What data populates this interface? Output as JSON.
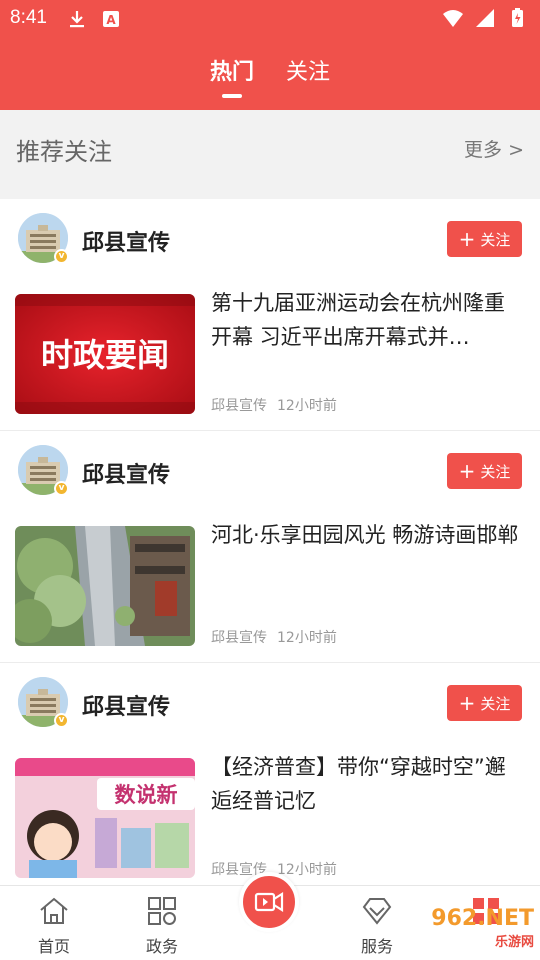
{
  "status_bar": {
    "time": "8:41",
    "icons_left": [
      "download-icon",
      "font-a-icon"
    ],
    "icons_right": [
      "wifi-icon",
      "signal-icon",
      "battery-charging-icon"
    ]
  },
  "top_tabs": [
    {
      "label": "热门",
      "active": true
    },
    {
      "label": "关注",
      "active": false
    }
  ],
  "recommend": {
    "title": "推荐关注",
    "more": "更多 >"
  },
  "follow_label": "关注",
  "feed": [
    {
      "source": "邱县宣传",
      "title": "第十九届亚洲运动会在杭州隆重开幕 习近平出席开幕式并…",
      "meta_source": "邱县宣传",
      "time": "12小时前",
      "thumb_text": "时政要闻"
    },
    {
      "source": "邱县宣传",
      "title": "河北·乐享田园风光 畅游诗画邯郸",
      "meta_source": "邱县宣传",
      "time": "12小时前",
      "thumb_text": ""
    },
    {
      "source": "邱县宣传",
      "title": "【经济普查】带你“穿越时空”邂逅经普记忆",
      "meta_source": "邱县宣传",
      "time": "12小时前",
      "thumb_text": "数说新"
    }
  ],
  "bottom_nav": [
    {
      "label": "首页",
      "icon": "home-icon"
    },
    {
      "label": "政务",
      "icon": "grid-icon"
    },
    {
      "label": "",
      "icon": "video-camera-icon"
    },
    {
      "label": "服务",
      "icon": "diamond-icon"
    },
    {
      "label": "",
      "icon": "apps-icon"
    }
  ],
  "watermark": {
    "brand": "962.NET",
    "sub": "乐游网"
  },
  "colors": {
    "brand_red": "#f0514b",
    "meta_gray": "#999999"
  }
}
